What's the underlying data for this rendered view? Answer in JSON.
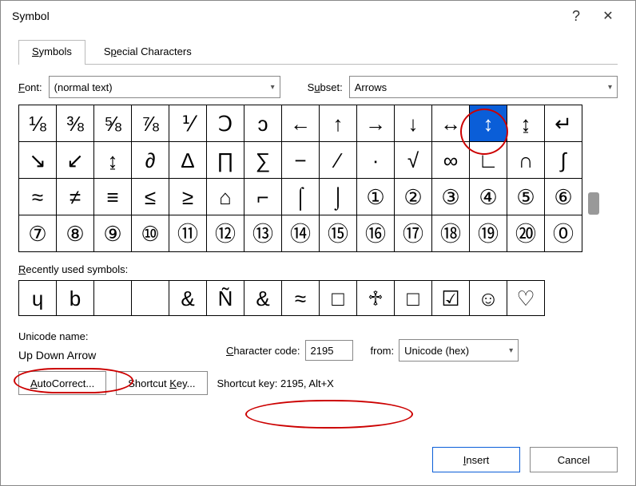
{
  "window": {
    "title": "Symbol"
  },
  "tabs": {
    "symbols": "Symbols",
    "special": "Special Characters"
  },
  "font": {
    "label": "Font:",
    "value": "(normal text)"
  },
  "subset": {
    "label": "Subset:",
    "value": "Arrows"
  },
  "grid": {
    "r0": [
      "⅛",
      "⅜",
      "⅝",
      "⅞",
      "⅟",
      "Ↄ",
      "ↄ",
      "←",
      "↑",
      "→",
      "↓",
      "↔",
      "↕",
      "↨",
      "↵"
    ],
    "r1": [
      "↘",
      "↙",
      "↨",
      "∂",
      "∆",
      "∏",
      "∑",
      "−",
      "∕",
      "∙",
      "√",
      "∞",
      "∟",
      "∩",
      "∫"
    ],
    "r2": [
      "≈",
      "≠",
      "≡",
      "≤",
      "≥",
      "⌂",
      "⌐",
      "⌠",
      "⌡",
      "①",
      "②",
      "③",
      "④",
      "⑤",
      "⑥"
    ],
    "r3": [
      "⑦",
      "⑧",
      "⑨",
      "⑩",
      "⑪",
      "⑫",
      "⑬",
      "⑭",
      "⑮",
      "⑯",
      "⑰",
      "⑱",
      "⑲",
      "⑳",
      "⓪"
    ]
  },
  "recent": {
    "label": "Recently used symbols:",
    "items": [
      "ɥ",
      "b",
      "",
      "",
      "&",
      "Ñ",
      "&",
      "≈",
      "□",
      "♱",
      "□",
      "☑",
      "☺",
      "♡"
    ]
  },
  "unicode": {
    "label": "Unicode name:",
    "value": "Up Down Arrow"
  },
  "charcode": {
    "label": "Character code:",
    "value": "2195"
  },
  "from": {
    "label": "from:",
    "value": "Unicode (hex)"
  },
  "buttons": {
    "autocorrect": "AutoCorrect...",
    "shortcutkey": "Shortcut Key...",
    "shortcut_info": "Shortcut key: 2195, Alt+X",
    "insert": "Insert",
    "cancel": "Cancel"
  }
}
